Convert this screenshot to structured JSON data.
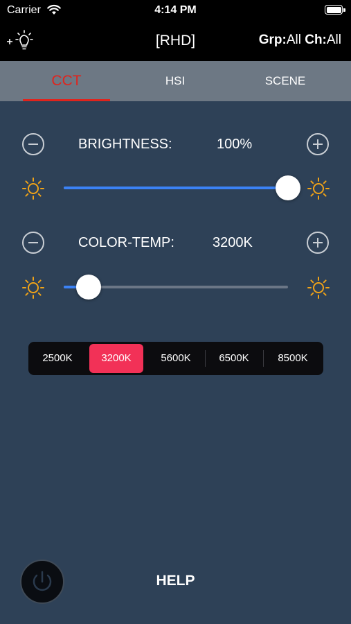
{
  "status_bar": {
    "carrier": "Carrier",
    "time": "4:14 PM"
  },
  "header": {
    "title": "[RHD]",
    "grp_label": "Grp:",
    "grp_value": "All",
    "ch_label": "Ch:",
    "ch_value": "All"
  },
  "tabs": [
    {
      "label": "CCT",
      "active": true
    },
    {
      "label": "HSI",
      "active": false
    },
    {
      "label": "SCENE",
      "active": false
    }
  ],
  "brightness": {
    "label": "BRIGHTNESS:",
    "value": "100%",
    "slider_fraction": 1.0
  },
  "color_temp": {
    "label": "COLOR-TEMP:",
    "value": "3200K",
    "slider_fraction": 0.11
  },
  "presets": {
    "options": [
      "2500K",
      "3200K",
      "5600K",
      "6500K",
      "8500K"
    ],
    "selected": "3200K"
  },
  "footer": {
    "help_label": "HELP"
  },
  "colors": {
    "background": "#2e4157",
    "tab_bar": "#6d7884",
    "active_tab": "#e0241d",
    "slider_fill": "#3b82f6",
    "sun_icon": "#f0a318",
    "selected_preset": "#f23157"
  }
}
